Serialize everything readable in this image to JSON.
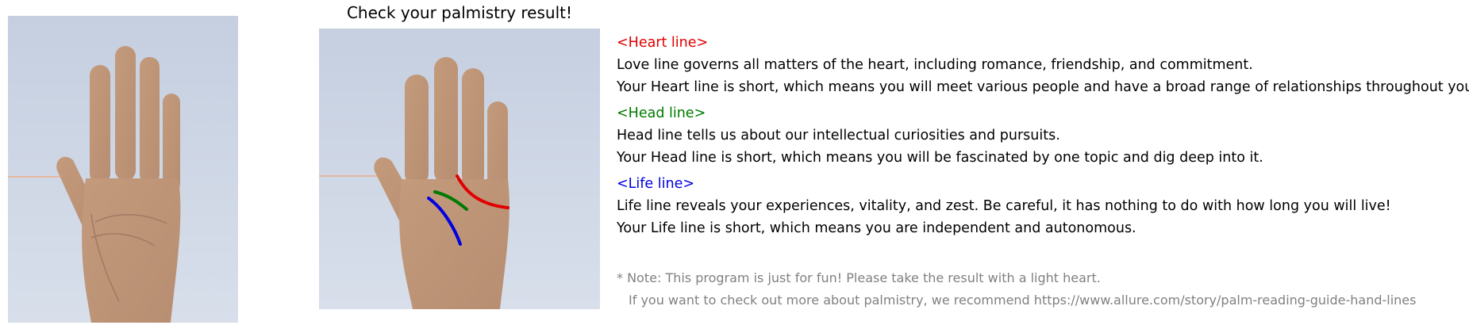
{
  "title": "Check your palmistry result!",
  "colors": {
    "heart": "#e00000",
    "head": "#007a00",
    "life": "#0000e0",
    "note": "#808080",
    "photo_background": "#ccd6e6",
    "skin": "#c8a084"
  },
  "sections": [
    {
      "heading": "<Heart line>",
      "color_key": "heart",
      "lines": [
        "Love line governs all matters of the heart, including romance, friendship, and commitment.",
        "Your Heart line is short, which means you will meet various people and have a broad range of relationships throughout your life."
      ]
    },
    {
      "heading": "<Head line>",
      "color_key": "head",
      "lines": [
        "Head line tells us about our intellectual curiosities and pursuits.",
        "Your Head line is short, which means you will be fascinated by one topic and dig deep into it."
      ]
    },
    {
      "heading": "<Life line>",
      "color_key": "life",
      "lines": [
        "Life line reveals your experiences, vitality, and zest. Be careful, it has nothing to do with how long you will live!",
        "Your Life line is short, which means you are independent and autonomous."
      ]
    }
  ],
  "note": {
    "line1": "* Note: This program is just for fun! Please take the result with a light heart.",
    "line2": "If you want to check out more about palmistry, we recommend https://www.allure.com/story/palm-reading-guide-hand-lines"
  }
}
